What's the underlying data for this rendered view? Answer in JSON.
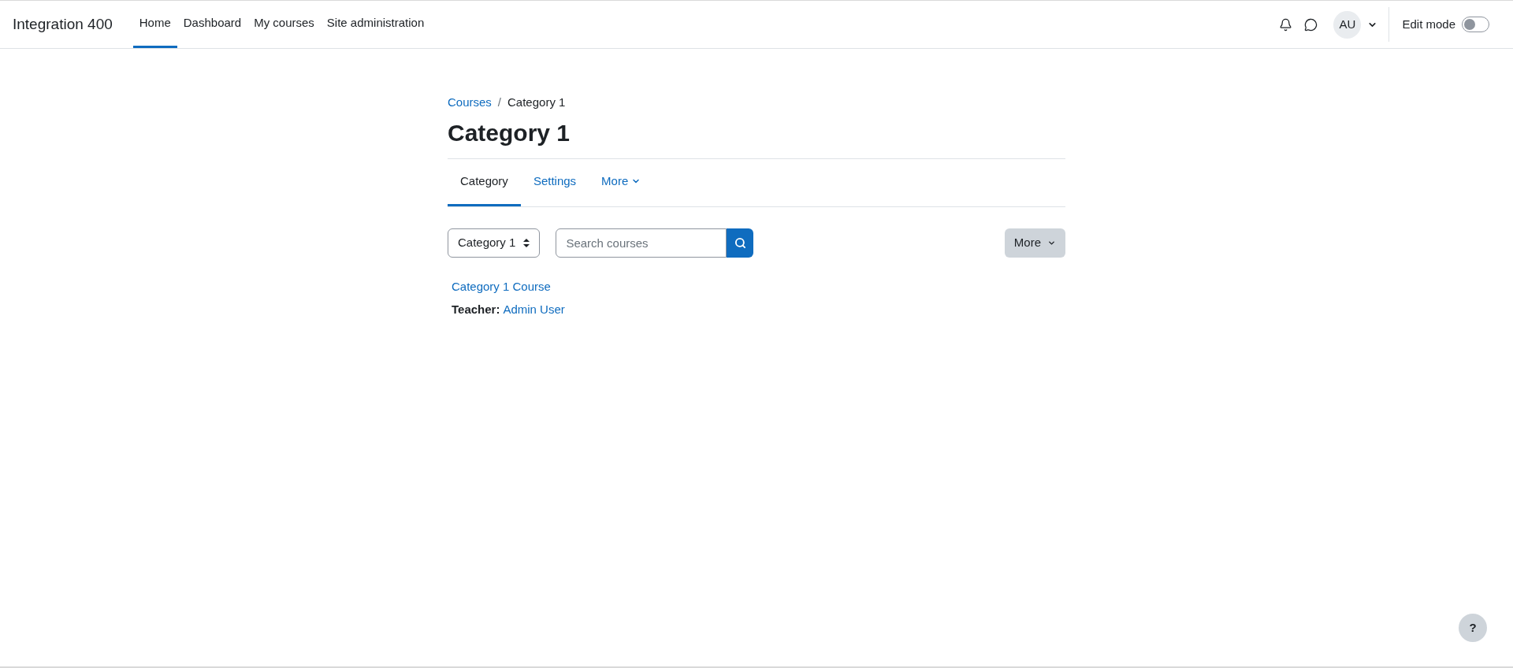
{
  "navbar": {
    "brand": "Integration 400",
    "items": [
      {
        "label": "Home",
        "selected": true
      },
      {
        "label": "Dashboard",
        "selected": false
      },
      {
        "label": "My courses",
        "selected": false
      },
      {
        "label": "Site administration",
        "selected": false
      }
    ],
    "avatar": "AU",
    "edit_mode": {
      "label": "Edit mode",
      "on": false
    }
  },
  "breadcrumb": [
    {
      "label": "Courses",
      "kind": "link"
    },
    {
      "label": "Category 1",
      "kind": "current"
    }
  ],
  "breadcrumb_separator": "/",
  "heading": "Category 1",
  "tabs": [
    {
      "label": "Category",
      "selected": true,
      "kind": "tab"
    },
    {
      "label": "Settings",
      "selected": false,
      "kind": "tab"
    },
    {
      "label": "More",
      "selected": false,
      "kind": "menu"
    }
  ],
  "category_select": {
    "value": "Category 1"
  },
  "search": {
    "placeholder": "Search courses"
  },
  "more_button": "More",
  "courses": [
    {
      "title": "Category 1 Course",
      "teacher_label": "Teacher:",
      "teacher": "Admin User"
    }
  ],
  "help": "?"
}
